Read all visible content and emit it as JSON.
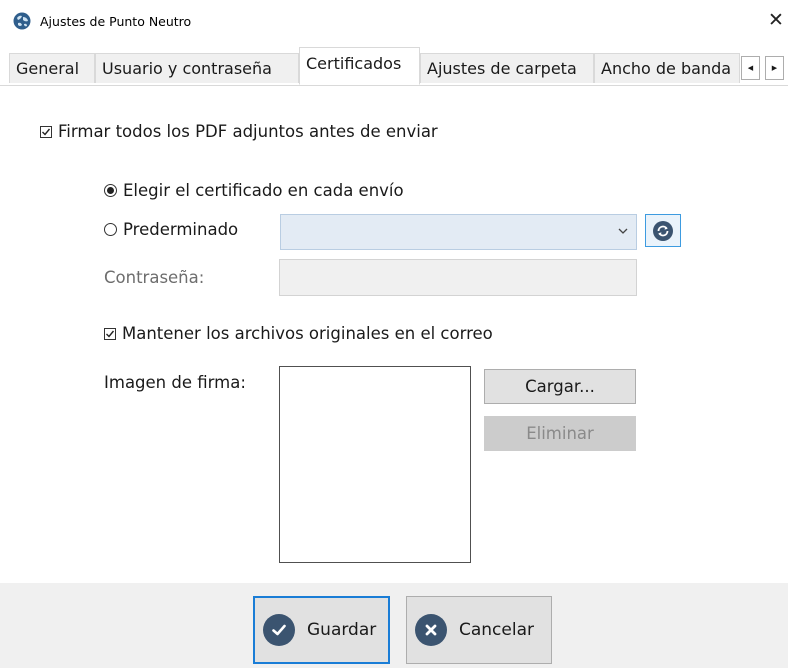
{
  "window": {
    "title": "Ajustes de Punto Neutro",
    "close_glyph": "✕",
    "icon": "globe-icon"
  },
  "tabs": [
    {
      "label": "General",
      "active": false
    },
    {
      "label": "Usuario y contraseña",
      "active": false
    },
    {
      "label": "Certificados",
      "active": true
    },
    {
      "label": "Ajustes de carpeta",
      "active": false
    },
    {
      "label": "Ancho de banda",
      "active": false
    }
  ],
  "tab_scroll": {
    "left_glyph": "◀",
    "right_glyph": "▶"
  },
  "certificates": {
    "sign_all_pdf": {
      "label": "Firmar todos los PDF adjuntos antes de enviar",
      "checked": true
    },
    "choose_each_send": {
      "label": "Elegir el certificado en cada envío",
      "selected": true
    },
    "predetermined": {
      "label": "Prederminado",
      "selected": false,
      "value": ""
    },
    "password": {
      "label": "Contraseña:",
      "value": ""
    },
    "keep_originals": {
      "label": "Mantener los archivos originales en el correo",
      "checked": true
    },
    "signature_image": {
      "label": "Imagen de firma:"
    },
    "load_button": "Cargar...",
    "delete_button": "Eliminar"
  },
  "footer": {
    "save_label": "Guardar",
    "cancel_label": "Cancelar"
  },
  "colors": {
    "accent": "#1a7dd6",
    "icon_dark": "#3b5470",
    "combo_bg": "#e3ebf4"
  }
}
